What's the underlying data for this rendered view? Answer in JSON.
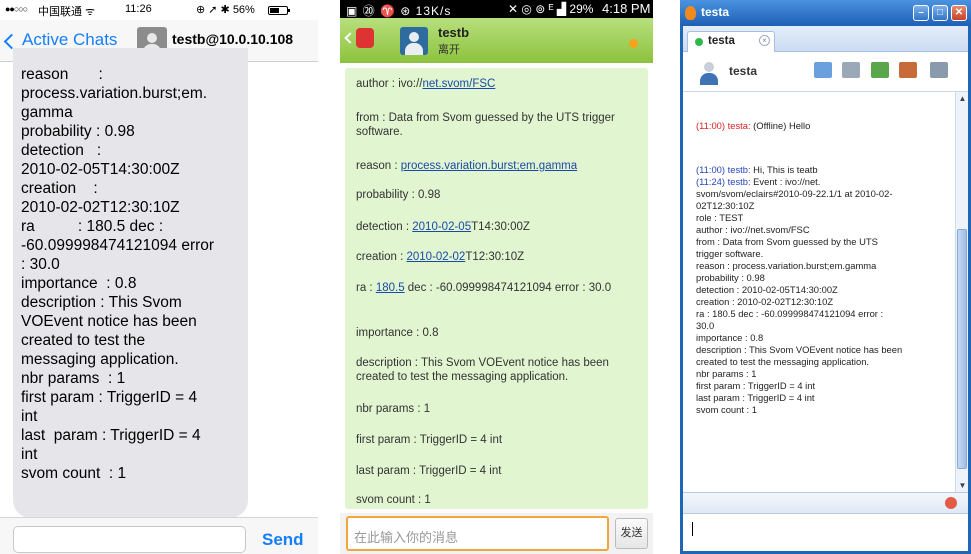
{
  "ios": {
    "status": {
      "signal": "●●○○○",
      "carrier": "中国联通 ᯤ",
      "time": "11:26",
      "right": "⊕ ➚ ✱ 56%"
    },
    "nav": {
      "back_label": "Active Chats",
      "peer": "testb@10.0.10.108"
    },
    "message_text": "reason       :\nprocess.variation.burst;em.\ngamma\nprobability : 0.98\ndetection   :\n2010-02-05T14:30:00Z\ncreation    :\n2010-02-02T12:30:10Z\nra          : 180.5 dec :\n-60.099998474121094 error\n: 30.0\nimportance  : 0.8\ndescription : This Svom\nVOEvent notice has been\ncreated to test the\nmessaging application.\nnbr params  : 1\nfirst param : TriggerID = 4\nint\nlast  param : TriggerID = 4\nint\nsvom count  : 1",
    "send_label": "Send",
    "battery_level": 0.56
  },
  "android": {
    "status": {
      "left": "▣ ⑳ ♈ ⊛ 13K/s",
      "right": "✕ ◎ ⊚ ᴱ ▟ 29%",
      "time": "4:18 PM"
    },
    "contact_name": "testb",
    "contact_status": "离开",
    "lines": [
      {
        "pre": "author      : ivo://",
        "link": "net.svom/FSC",
        "post": ""
      },
      {
        "text": "from        : Data from Svom guessed by the UTS trigger software."
      },
      {
        "pre": "reason      : ",
        "link": "process.variation.burst;em.gamma",
        "post": ""
      },
      {
        "text": "probability : 0.98"
      },
      {
        "pre": "detection   : ",
        "link": "2010-02-05",
        "post": "T14:30:00Z"
      },
      {
        "pre": "creation    : ",
        "link": "2010-02-02",
        "post": "T12:30:10Z"
      },
      {
        "pre": "ra          : ",
        "link": "180.5",
        "post": " dec : -60.099998474121094 error : 30.0"
      },
      {
        "text": "importance  : 0.8"
      },
      {
        "text": "description : This Svom VOEvent notice has been created to test the messaging application."
      },
      {
        "text": "nbr params  : 1"
      },
      {
        "text": "first param : TriggerID = 4 int"
      },
      {
        "text": "last  param : TriggerID = 4 int"
      },
      {
        "text": "svom count  : 1"
      }
    ],
    "input_placeholder": "在此输入你的消息",
    "send_label": "发送"
  },
  "windows": {
    "title": "testa",
    "tab_label": "testa",
    "user": "testa",
    "controls": {
      "minimize": "–",
      "maximize": "□",
      "close": "✕"
    },
    "tool_colors": [
      "#6aa0de",
      "#9aa8b8",
      "#5aa64a",
      "#c86b3a",
      "#8a9aad"
    ],
    "messages": [
      {
        "ts": "(11:00)",
        "who": "testa:",
        "rest": " (Offline) Hello",
        "who_color": "r"
      },
      {
        "ts": "(11:00)",
        "who": "testb:",
        "rest": " Hi, This is teatb",
        "who_color": "b"
      },
      {
        "ts": "(11:24)",
        "who": "testb:",
        "rest": " Event    : ivo://net.",
        "who_color": "b"
      }
    ],
    "body_lines": [
      "svom/svom/eclairs#2010-09-22.1/1 at 2010-02-",
      "02T12:30:10Z",
      "role       : TEST",
      "author     : ivo://net.svom/FSC",
      "from       : Data from Svom guessed by the UTS",
      "trigger software.",
      "reason     : process.variation.burst;em.gamma",
      "probability : 0.98",
      "detection  : 2010-02-05T14:30:00Z",
      "creation   : 2010-02-02T12:30:10Z",
      "ra         : 180.5 dec : -60.099998474121094 error :",
      "30.0",
      "importance : 0.8",
      "description : This Svom VOEvent notice has been",
      "created to test the messaging application.",
      "nbr params : 1",
      "first param : TriggerID = 4 int",
      "last param : TriggerID = 4 int",
      "svom count : 1"
    ],
    "scroll": {
      "up": "▲",
      "down": "▼"
    }
  }
}
